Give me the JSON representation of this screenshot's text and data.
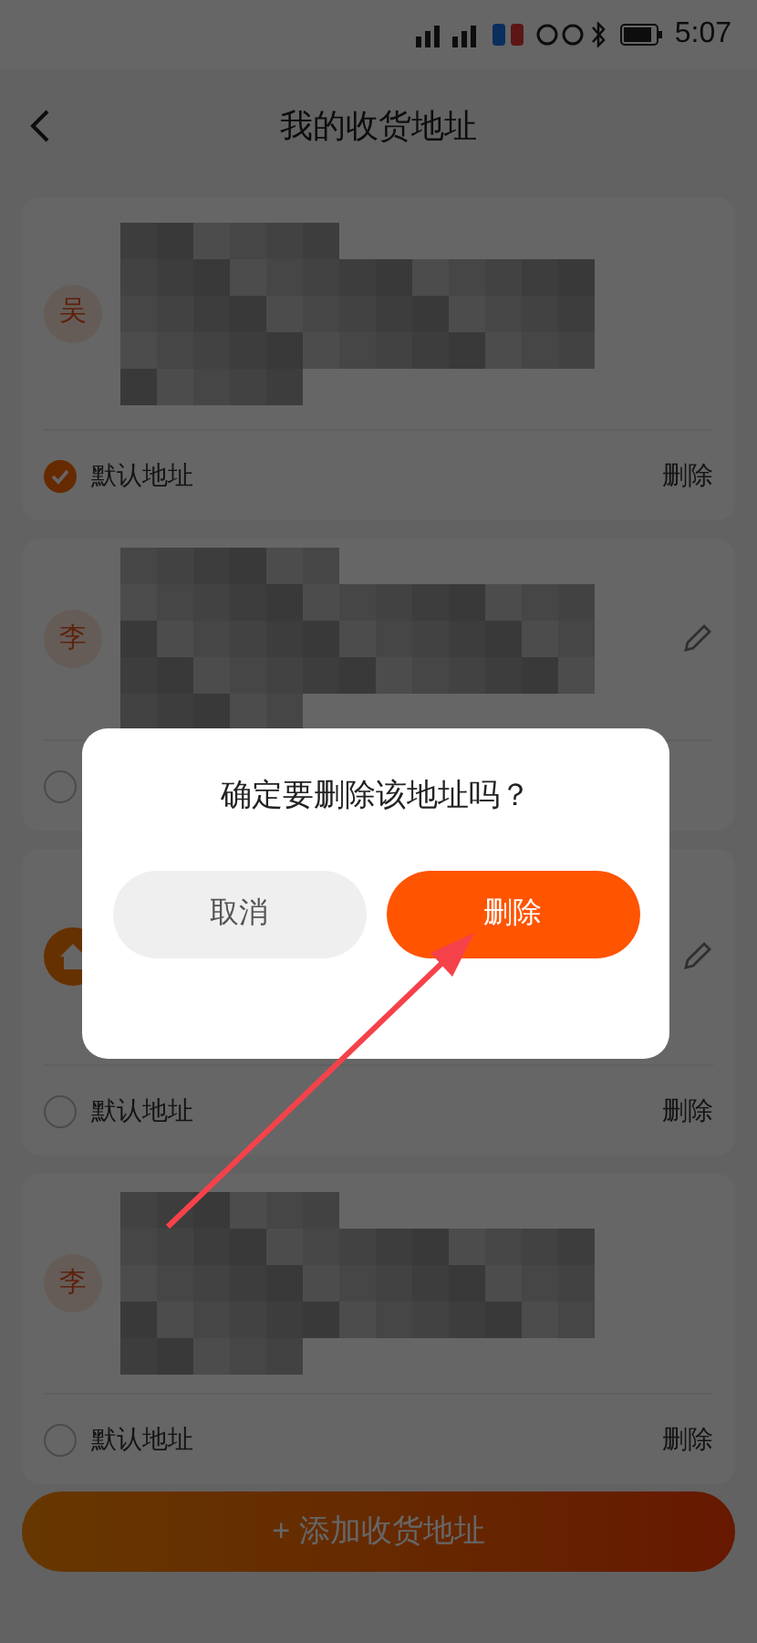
{
  "status_bar": {
    "time": "5:07"
  },
  "header": {
    "title": "我的收货地址"
  },
  "addresses": [
    {
      "avatar": {
        "kind": "letter",
        "text": "吴"
      },
      "redacted": true,
      "editable": false,
      "default": {
        "checked": true,
        "label": "默认地址"
      },
      "delete": "删除"
    },
    {
      "avatar": {
        "kind": "letter",
        "text": "李"
      },
      "redacted": true,
      "editable": true,
      "default": {
        "checked": false
      }
    },
    {
      "avatar": {
        "kind": "home"
      },
      "redacted": false,
      "editable": true,
      "default": {
        "checked": false,
        "label": "默认地址"
      },
      "delete": "删除"
    },
    {
      "avatar": {
        "kind": "letter",
        "text": "李"
      },
      "redacted": true,
      "editable": false,
      "default": {
        "checked": false,
        "label": "默认地址"
      },
      "delete": "删除"
    }
  ],
  "add_button": "+ 添加收货地址",
  "dialog": {
    "message": "确定要删除该地址吗？",
    "buttons": [
      {
        "label": "取消",
        "kind": "cancel"
      },
      {
        "label": "删除",
        "kind": "confirm"
      }
    ]
  },
  "annotation": {
    "kind": "arrow"
  }
}
